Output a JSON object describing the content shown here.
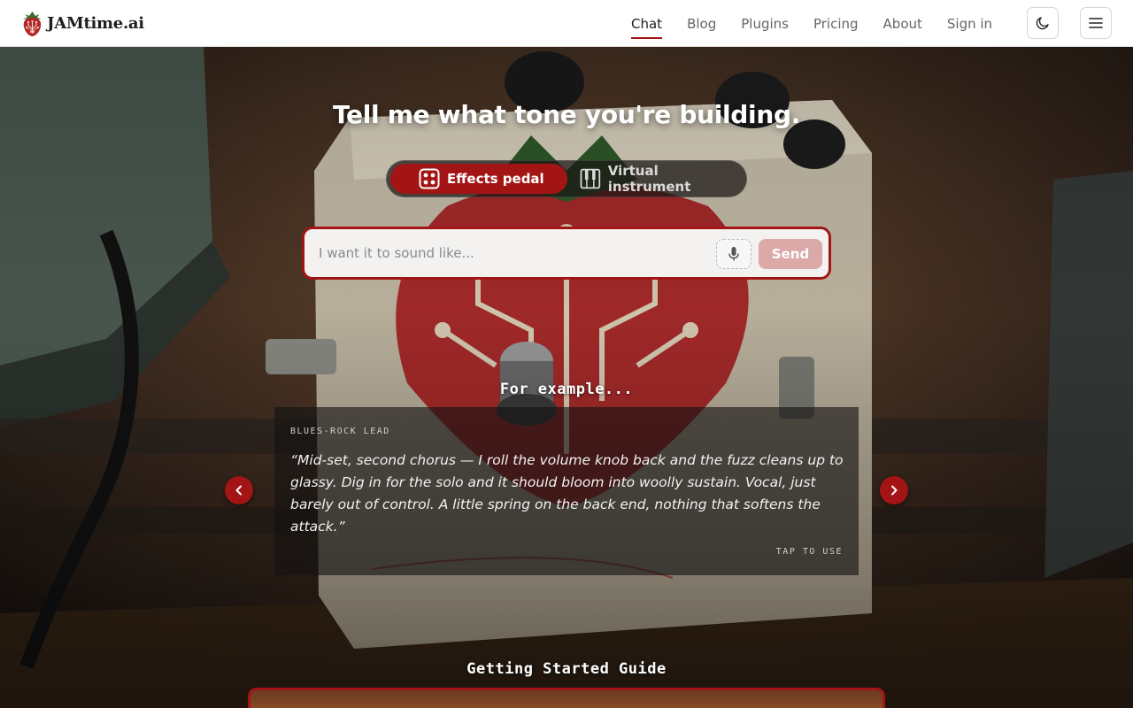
{
  "brand": {
    "name": "JAMtime.ai",
    "logo_icon": "strawberry-logo-icon"
  },
  "nav": {
    "items": [
      {
        "label": "Chat",
        "active": true
      },
      {
        "label": "Blog",
        "active": false
      },
      {
        "label": "Plugins",
        "active": false
      },
      {
        "label": "Pricing",
        "active": false
      },
      {
        "label": "About",
        "active": false
      },
      {
        "label": "Sign in",
        "active": false
      }
    ],
    "theme_toggle_icon": "moon-icon",
    "menu_icon": "hamburger-menu-icon"
  },
  "hero": {
    "headline": "Tell me what tone you're building.",
    "modes": [
      {
        "label": "Effects pedal",
        "icon": "pedal-knobs-icon",
        "selected": true
      },
      {
        "label": "Virtual instrument",
        "icon": "piano-keys-icon",
        "selected": false
      }
    ],
    "input": {
      "placeholder": "I want it to sound like...",
      "value": ""
    },
    "mic_icon": "microphone-icon",
    "send_label": "Send"
  },
  "examples": {
    "heading": "For example...",
    "current": {
      "tag": "BLUES-ROCK LEAD",
      "quote": "“Mid-set, second chorus — I roll the volume knob back and the fuzz cleans up to glassy. Dig in for the solo and it should bloom into woolly sustain. Vocal, just barely out of control. A little spring on the back end, nothing that softens the attack.”",
      "action": "TAP TO USE"
    },
    "prev_icon": "chevron-left-icon",
    "next_icon": "chevron-right-icon"
  },
  "guide": {
    "heading": "Getting Started Guide"
  },
  "colors": {
    "accent": "#a31515",
    "send_disabled": "#dca9a9",
    "header_bg": "#ffffff"
  }
}
